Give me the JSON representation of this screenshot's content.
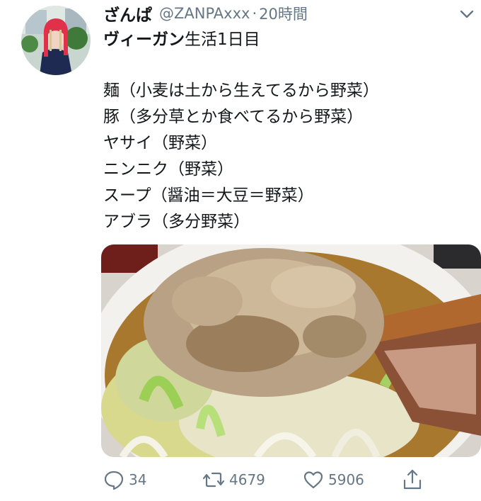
{
  "tweet": {
    "display_name": "ざんぱ",
    "handle": "@ZANPAxxx",
    "separator": "·",
    "timestamp": "20時間",
    "title_bold": "ヴィーガン",
    "title_rest": "生活1日目",
    "lines": [
      "麺（小麦は土から生えてるから野菜）",
      "豚（多分草とか食べてるから野菜）",
      "ヤサイ（野菜）",
      "ニンニク（野菜）",
      "スープ（醤油＝大豆＝野菜）",
      "アブラ（多分野菜）"
    ],
    "actions": {
      "reply_count": "34",
      "retweet_count": "4679",
      "like_count": "5906"
    }
  },
  "colors": {
    "text": "#14171a",
    "secondary": "#657786",
    "background": "#ffffff"
  },
  "icons": {
    "reply": "speech-bubble-icon",
    "retweet": "retweet-arrows-icon",
    "like": "heart-outline-icon",
    "share": "share-upload-icon",
    "menu": "chevron-down-icon"
  }
}
